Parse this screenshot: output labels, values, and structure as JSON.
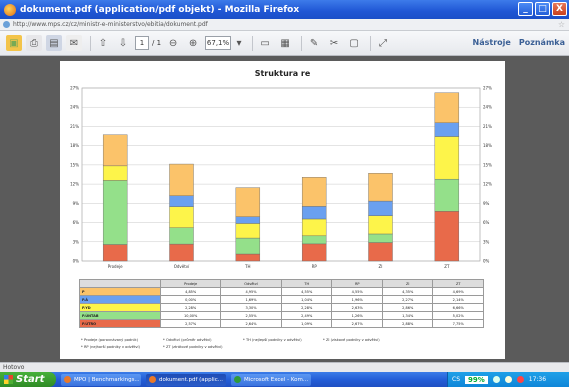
{
  "window": {
    "title": "dokument.pdf (application/pdf objekt) - Mozilla Firefox",
    "controls": [
      "_",
      "□",
      "X"
    ]
  },
  "address_bar": {
    "url": "http://www.mps.cz/cz/ministr-e-ministerstvo/ebitia/dokument.pdf"
  },
  "pdf_toolbar": {
    "page_current": "1",
    "page_total": "/ 1",
    "zoom": "67,1%",
    "tools_label": "Nástroje",
    "notes_label": "Poznámka"
  },
  "status": {
    "text": "Hotovo"
  },
  "taskbar": {
    "start_label": "Start",
    "tasks": [
      {
        "label": "MPO | Benchmarkings...",
        "color": "#e8782a"
      },
      {
        "label": "dokument.pdf (applic...",
        "color": "#e8782a"
      },
      {
        "label": "Microsoft Excel - Kom...",
        "color": "#2f9a3a"
      }
    ],
    "tray_lang": "CS",
    "tray_percent": "99%",
    "tray_time": "17:36"
  },
  "colors": {
    "PA": "#e86a4a",
    "PINTAB": "#94e08a",
    "PYD": "#fdf44a",
    "PA2": "#6aa0f0",
    "P": "#fbc36a"
  },
  "chart_data": {
    "type": "bar",
    "stacked": true,
    "title": "Struktura re",
    "categories": [
      "Prodeje",
      "Odvětví",
      "TH",
      "RP",
      "ZI",
      "ZT"
    ],
    "ylim": [
      0,
      27
    ],
    "yticks": [
      "0%",
      "3%",
      "6%",
      "9%",
      "12%",
      "15%",
      "18%",
      "21%",
      "24%",
      "27%"
    ],
    "series": [
      {
        "name": "P.ÚTRO",
        "color": "#e86a4a",
        "values": [
          2.57,
          2.64,
          1.09,
          2.67,
          2.88,
          7.75
        ]
      },
      {
        "name": "P.ÚNTAB",
        "color": "#94e08a",
        "values": [
          10.0,
          2.55,
          2.49,
          1.26,
          1.34,
          5.02
        ]
      },
      {
        "name": "P.YD",
        "color": "#fdf44a",
        "values": [
          2.28,
          3.3,
          2.28,
          2.63,
          2.86,
          6.66
        ]
      },
      {
        "name": "P.Á",
        "color": "#6aa0f0",
        "values": [
          0.0,
          1.69,
          1.04,
          1.96,
          2.27,
          2.14
        ]
      },
      {
        "name": "P",
        "color": "#fbc36a",
        "values": [
          4.85,
          4.95,
          4.55,
          4.55,
          4.35,
          4.69
        ]
      }
    ],
    "table": {
      "header": [
        "",
        "Prodeje",
        "Odvětví",
        "TH",
        "RP",
        "ZI",
        "ZT"
      ],
      "rows": [
        {
          "label": "P",
          "cells": [
            "4,85%",
            "4,95%",
            "4,55%",
            "4,55%",
            "4,35%",
            "4,69%"
          ]
        },
        {
          "label": "P.Á",
          "cells": [
            "0,00%",
            "1,69%",
            "1,04%",
            "1,96%",
            "2,27%",
            "2,14%"
          ]
        },
        {
          "label": "P.YD",
          "cells": [
            "2,28%",
            "3,30%",
            "2,28%",
            "2,63%",
            "2,86%",
            "6,66%"
          ]
        },
        {
          "label": "P.ÚNTAB",
          "cells": [
            "10,00%",
            "2,55%",
            "2,49%",
            "1,26%",
            "1,34%",
            "5,02%"
          ]
        },
        {
          "label": "P.ÚTRO",
          "cells": [
            "2,57%",
            "2,64%",
            "1,09%",
            "2,67%",
            "2,88%",
            "7,75%"
          ]
        }
      ]
    },
    "notes": [
      "* Prodeje (porovnávaný podnik)",
      "* Odvětví (průměr odvětví)",
      "* TH (nejlepší podniky v odvětví)",
      "* RP (nejhorší podniky v odvětví)",
      "* ZI (ziskové podniky v odvětví)",
      "* ZT (ztrátové podniky v odvětví)"
    ]
  }
}
